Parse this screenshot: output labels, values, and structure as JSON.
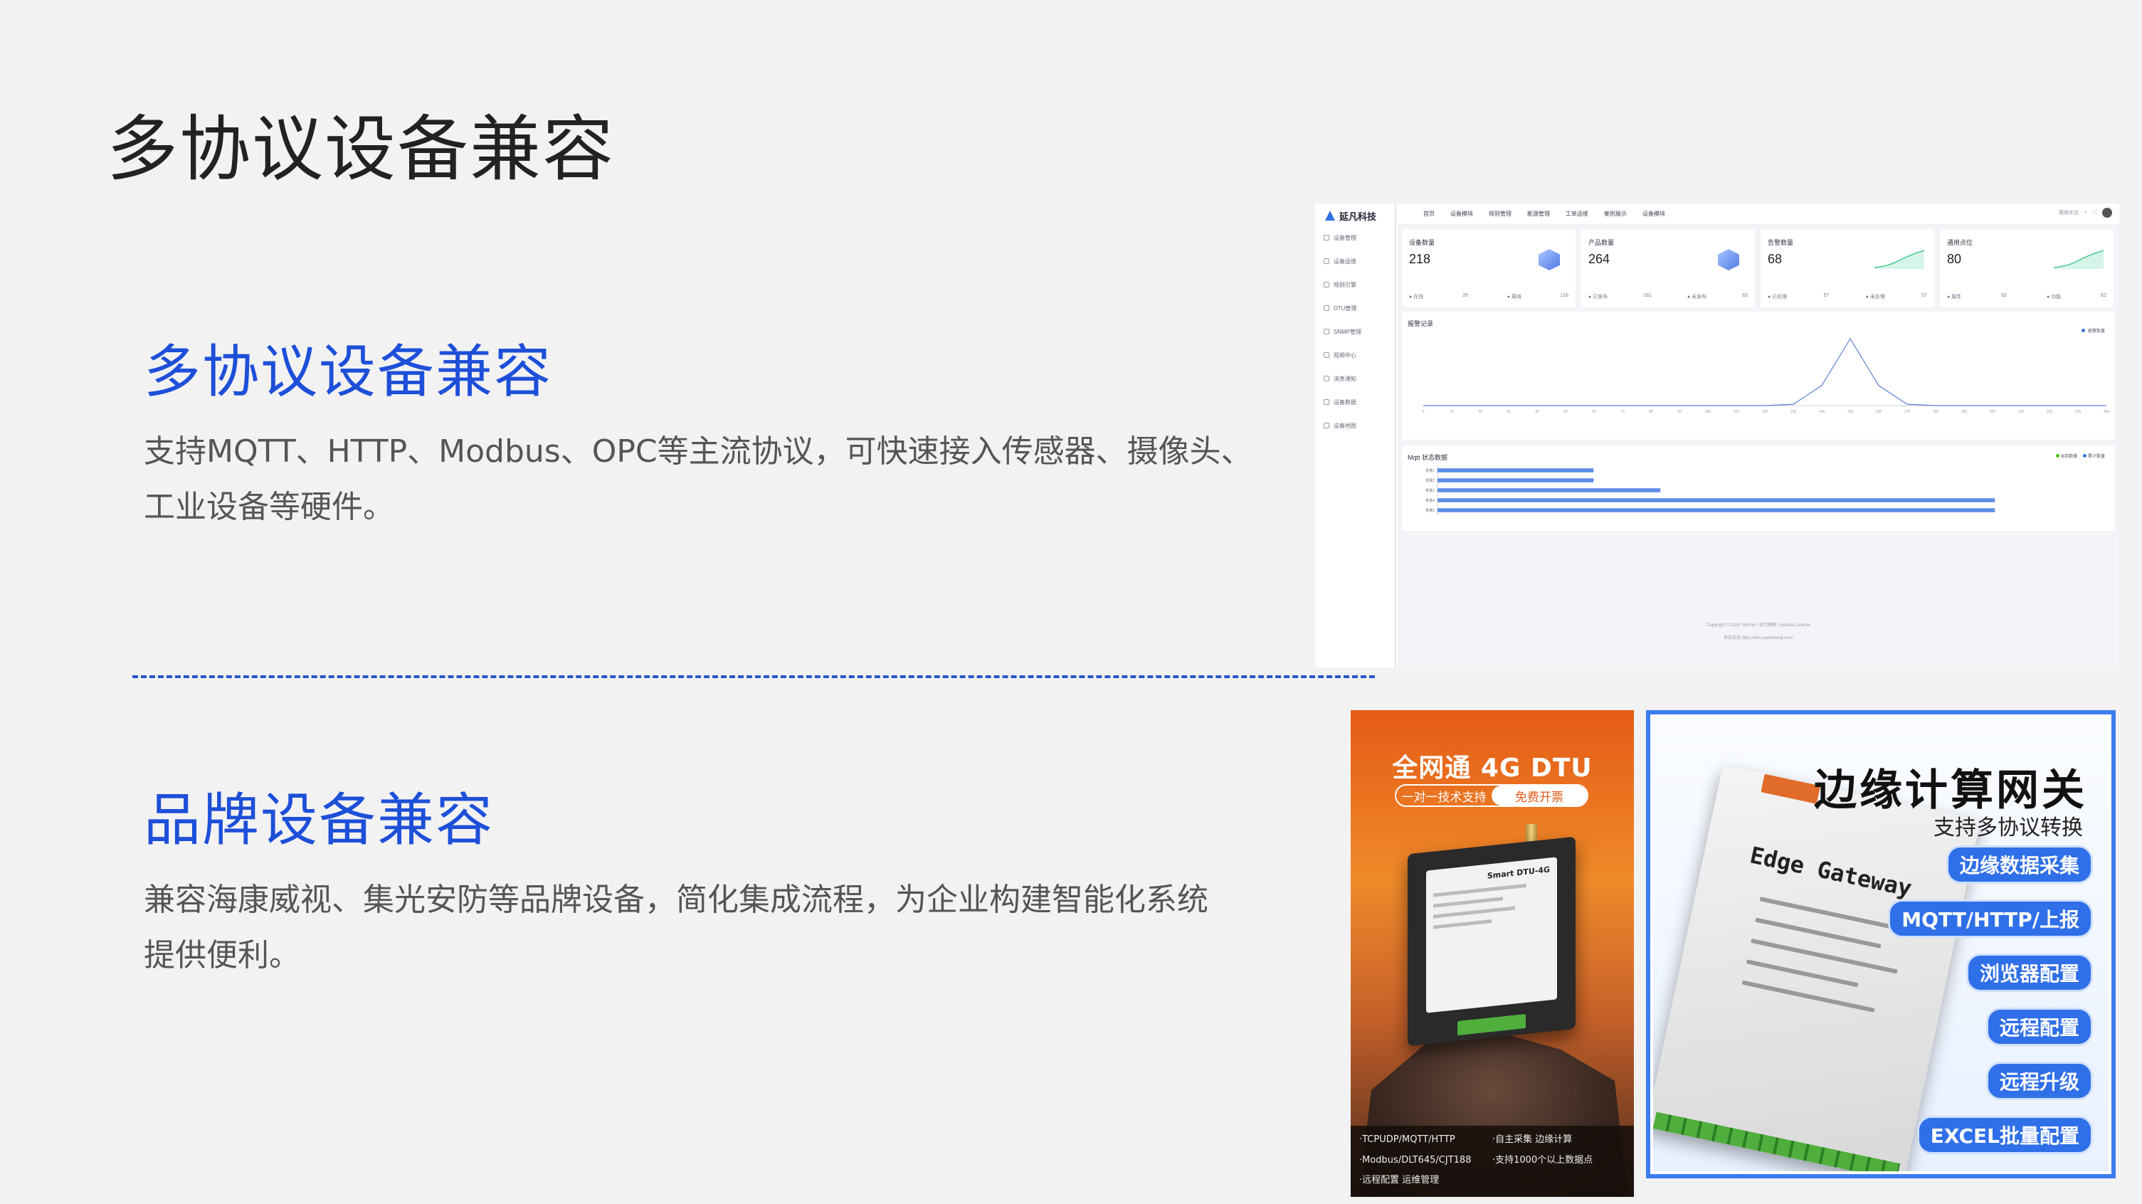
{
  "page": {
    "title": "多协议设备兼容"
  },
  "section1": {
    "title": "多协议设备兼容",
    "body_line1": "支持MQTT、HTTP、Modbus、OPC等主流协议，可快速接入传感器、摄像头、",
    "body_line2": "工业设备等硬件。"
  },
  "section2": {
    "title": "品牌设备兼容",
    "body_line1": "兼容海康威视、集光安防等品牌设备，简化集成流程，为企业构建智能化系统",
    "body_line2": "提供便利。"
  },
  "dashboard": {
    "brand": "延凡科技",
    "sidebar": [
      "设备管理",
      "设备运维",
      "规则引擎",
      "DTU管理",
      "SNMP管理",
      "视频中心",
      "消息通知",
      "设备数据",
      "设备地图"
    ],
    "topnav": [
      "首页",
      "设备模块",
      "规则管理",
      "能源管理",
      "工单运维",
      "案例展示",
      "设备模块"
    ],
    "topright": "简体中文",
    "cards": [
      {
        "title": "设备数量",
        "value": "218",
        "f1": "在线",
        "f1v": "26",
        "f2": "离线",
        "f2v": "116"
      },
      {
        "title": "产品数量",
        "value": "264",
        "f1": "已发布",
        "f1v": "181",
        "f2": "未发布",
        "f2v": "63"
      },
      {
        "title": "告警数量",
        "value": "68",
        "f1": "已处理",
        "f1v": "57",
        "f2": "未处理",
        "f2v": "57"
      },
      {
        "title": "通用点位",
        "value": "80",
        "f1": "属性",
        "f1v": "62",
        "f2": "功能",
        "f2v": "62"
      }
    ],
    "alarm_panel": {
      "title": "报警记录",
      "legend": "报警数量"
    },
    "mqtt_panel": {
      "title": "Mqtt 状态数据",
      "legend1": "当前数量",
      "legend2": "累计数量"
    },
    "footer1": "Copyright © 2024 YanFan / 延凡物联 | Apache License",
    "footer2": "项目支持 https://doc.yanfanwuji.com/"
  },
  "chart_data": [
    {
      "type": "line",
      "title": "报警记录",
      "x": [
        0,
        10,
        20,
        30,
        40,
        50,
        60,
        70,
        80,
        90,
        100,
        110,
        120,
        130,
        140,
        150,
        160,
        170,
        180,
        190,
        200,
        210,
        220,
        230,
        240
      ],
      "series": [
        {
          "name": "报警数量",
          "values": [
            0,
            0,
            0,
            0,
            0,
            0,
            0,
            0,
            0,
            0,
            0,
            0,
            0,
            0.02,
            0.3,
            1,
            0.3,
            0.02,
            0,
            0,
            0,
            0,
            0,
            0,
            0
          ]
        }
      ],
      "ylim": [
        0,
        1
      ]
    },
    {
      "type": "bar",
      "title": "Mqtt 状态数据",
      "categories": [
        "数量1",
        "数量2",
        "数量3",
        "数量4",
        "数量5"
      ],
      "values": [
        14,
        14,
        20,
        50,
        50
      ],
      "xlim": [
        0,
        60
      ]
    }
  ],
  "poster1": {
    "title": "全网通 4G DTU",
    "pill_left": "一对一技术支持",
    "pill_right": "免费开票",
    "device_name": "Smart DTU-4G",
    "features": [
      "·TCPUDP/MQTT/HTTP",
      "·自主采集 边缘计算",
      "·Modbus/DLT645/CJT188",
      "·支持1000个以上数据点",
      "·远程配置 运维管理"
    ]
  },
  "poster2": {
    "title": "边缘计算网关",
    "subtitle": "支持多协议转换",
    "device_name": "Edge Gateway",
    "tags": [
      "边缘数据采集",
      "MQTT/HTTP/上报",
      "浏览器配置",
      "远程配置",
      "远程升级",
      "EXCEL批量配置"
    ],
    "accent": "#2f6fe8"
  }
}
